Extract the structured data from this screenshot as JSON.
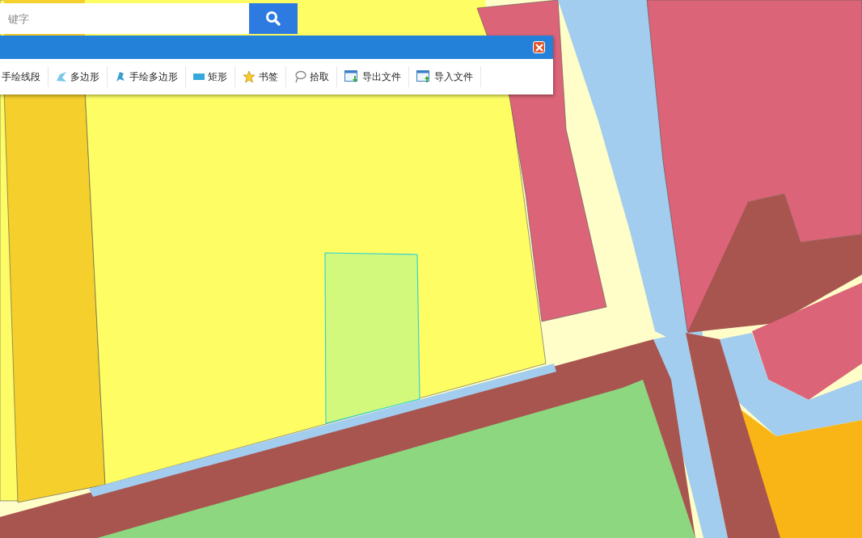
{
  "search": {
    "placeholder": "键字"
  },
  "toolbar": {
    "tools": [
      {
        "kind": "none",
        "label": "手绘线段"
      },
      {
        "kind": "polygon",
        "label": "多边形"
      },
      {
        "kind": "freehand",
        "label": "手绘多边形"
      },
      {
        "kind": "rect",
        "label": "矩形"
      },
      {
        "kind": "star",
        "label": "书签"
      },
      {
        "kind": "pick",
        "label": "拾取"
      },
      {
        "kind": "export",
        "label": "导出文件"
      },
      {
        "kind": "import",
        "label": "导入文件"
      }
    ]
  }
}
